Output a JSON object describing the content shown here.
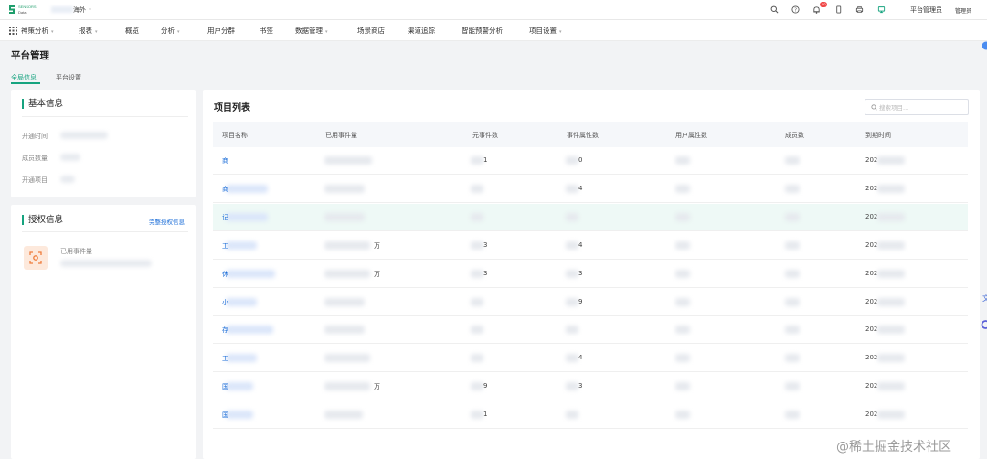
{
  "header": {
    "brand_line1": "SENSORS",
    "brand_line2": "Data",
    "org_suffix": "海外",
    "notification_count": "10",
    "role_admin": "平台管理员",
    "role_user": "管理员"
  },
  "nav": {
    "items": [
      {
        "label": "神策分析",
        "dropdown": true
      },
      {
        "label": "报表",
        "dropdown": true
      },
      {
        "label": "概览",
        "dropdown": false
      },
      {
        "label": "分析",
        "dropdown": true
      },
      {
        "label": "用户分群",
        "dropdown": false
      },
      {
        "label": "书签",
        "dropdown": false
      },
      {
        "label": "数据管理",
        "dropdown": true
      },
      {
        "label": "场景商店",
        "dropdown": false
      },
      {
        "label": "渠道追踪",
        "dropdown": false
      },
      {
        "label": "智能预警分析",
        "dropdown": false
      },
      {
        "label": "项目设置",
        "dropdown": true
      }
    ]
  },
  "page": {
    "title": "平台管理",
    "tabs": [
      {
        "label": "全局信息",
        "active": true
      },
      {
        "label": "平台设置",
        "active": false
      }
    ]
  },
  "basic_info": {
    "title": "基本信息",
    "fields": [
      {
        "label": "开通时间"
      },
      {
        "label": "成员数量"
      },
      {
        "label": "开通项目"
      }
    ]
  },
  "auth_info": {
    "title": "授权信息",
    "link": "完整授权信息",
    "used_events_label": "已用事件量"
  },
  "project_list": {
    "title": "项目列表",
    "search_placeholder": "搜索项目...",
    "columns": [
      "项目名称",
      "已用事件量",
      "元事件数",
      "事件属性数",
      "用户属性数",
      "成员数",
      "到期时间"
    ],
    "rows": [
      {
        "name": "商",
        "events": "",
        "meta": "1",
        "props": "0",
        "expire": "202",
        "highlighted": false
      },
      {
        "name": "商",
        "events": "",
        "meta": "",
        "props": "4",
        "expire": "202",
        "highlighted": false
      },
      {
        "name": "记",
        "events": "",
        "meta": "",
        "props": "",
        "expire": "202",
        "highlighted": true
      },
      {
        "name": "工",
        "events": "万",
        "meta": "3",
        "props": "4",
        "expire": "202",
        "highlighted": false
      },
      {
        "name": "休",
        "events": "万",
        "meta": "3",
        "props": "3",
        "expire": "202",
        "highlighted": false
      },
      {
        "name": "小",
        "events": "",
        "meta": "",
        "props": "9",
        "expire": "202",
        "highlighted": false
      },
      {
        "name": "存",
        "events": "",
        "meta": "",
        "props": "",
        "expire": "202",
        "highlighted": false
      },
      {
        "name": "工",
        "events": "",
        "meta": "",
        "props": "4",
        "expire": "202",
        "highlighted": false
      },
      {
        "name": "国",
        "events": "万",
        "meta": "9",
        "props": "3",
        "expire": "202",
        "highlighted": false
      },
      {
        "name": "国",
        "events": "",
        "meta": "1",
        "props": "",
        "expire": "202",
        "highlighted": false
      }
    ]
  },
  "watermark": "@稀土掘金技术社区",
  "colors": {
    "accent": "#16a37f",
    "link": "#1e6fd8",
    "badge": "#f04848",
    "row_highlight": "#eef9f6"
  }
}
